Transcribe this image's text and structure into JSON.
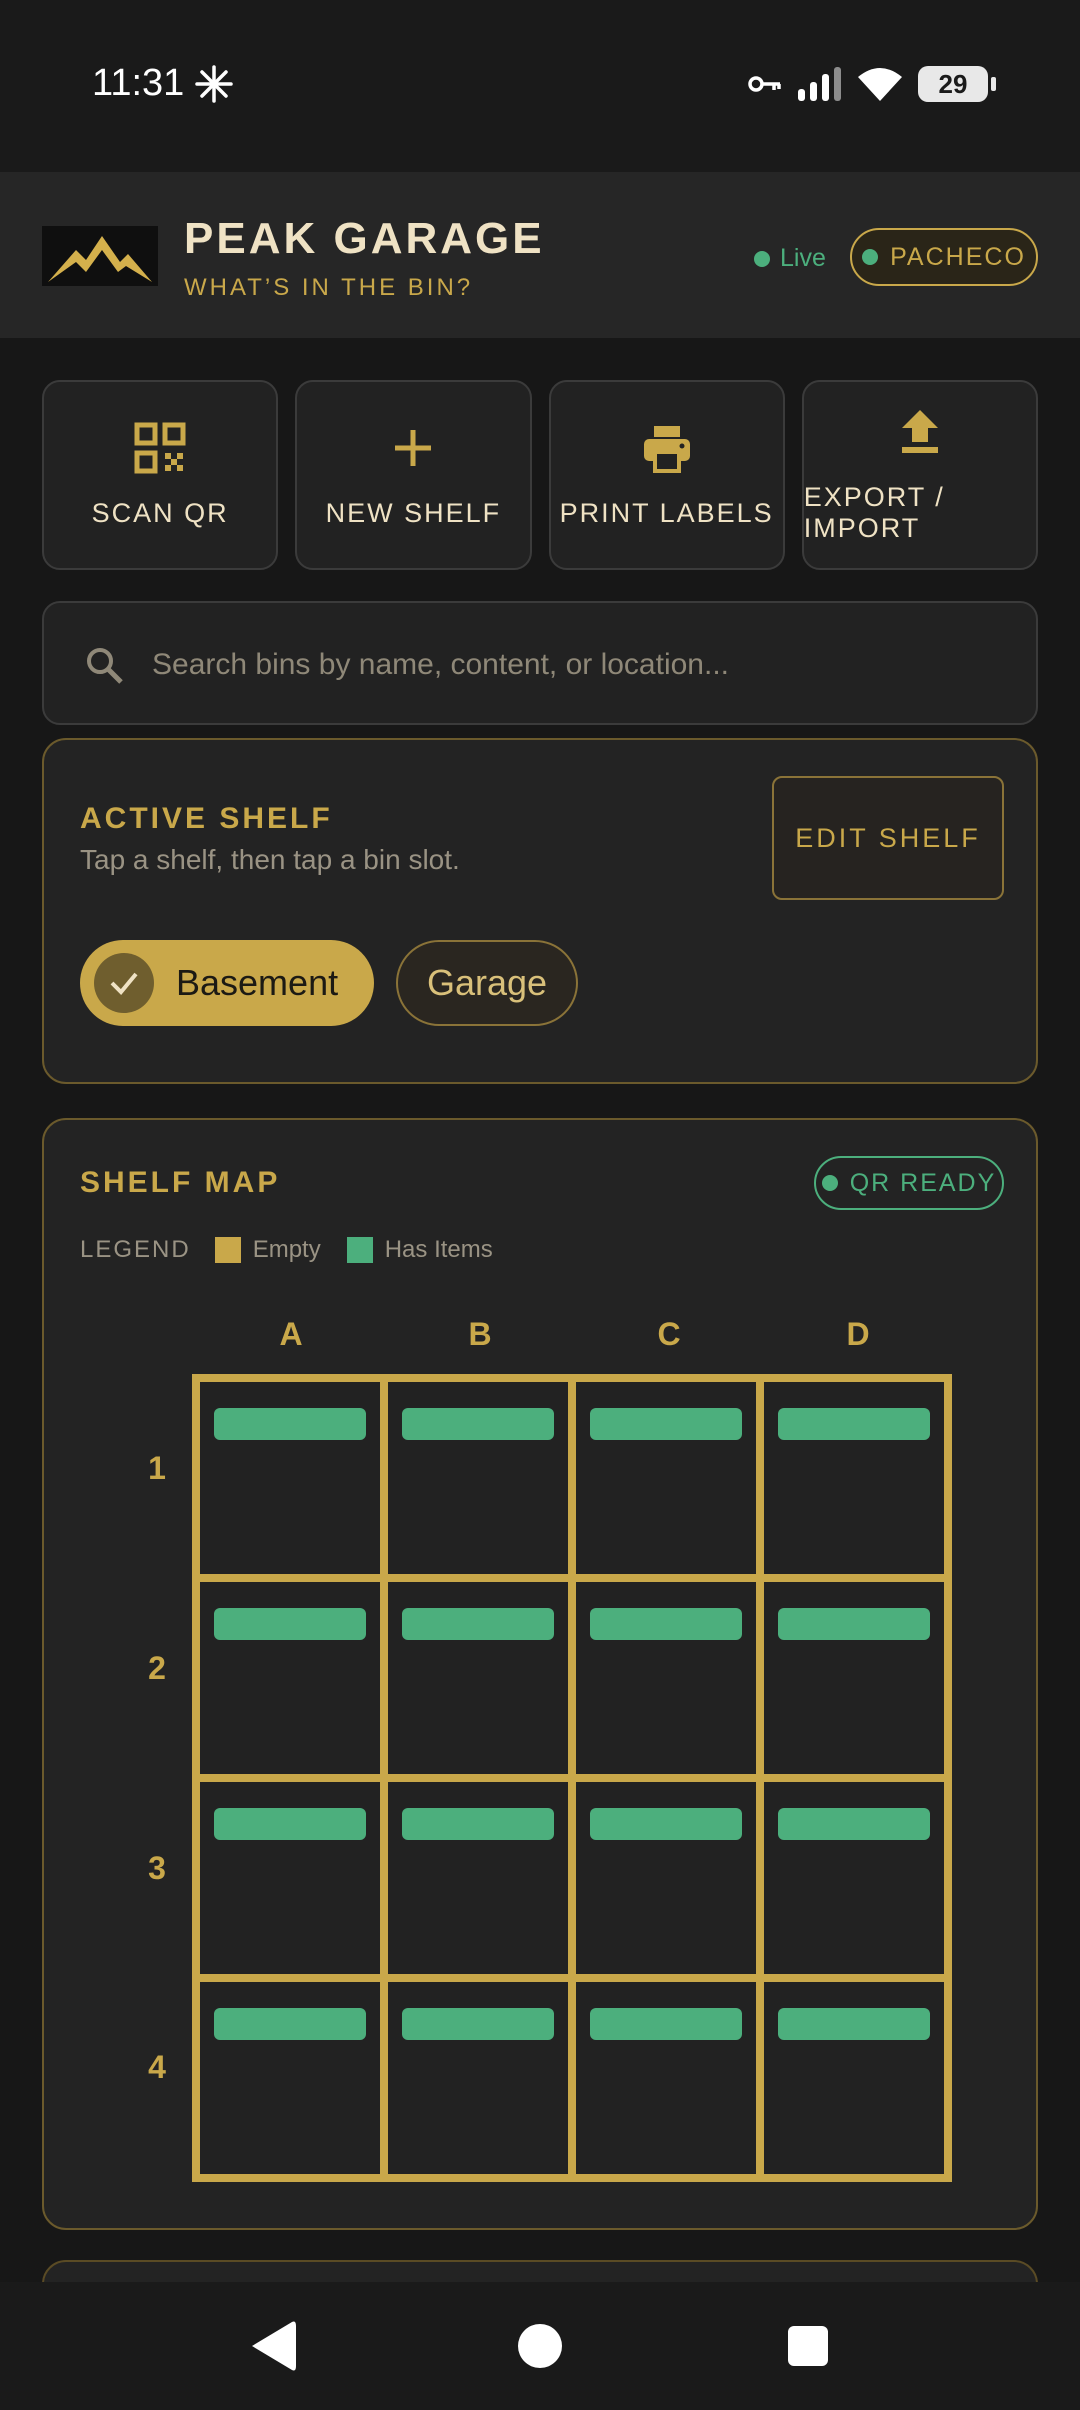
{
  "status_bar": {
    "time": "11:31",
    "battery": "29",
    "icons": [
      "spark-icon",
      "key-icon",
      "signal-icon",
      "wifi-icon",
      "battery-icon"
    ]
  },
  "header": {
    "logo": "mountain-logo",
    "title": "PEAK GARAGE",
    "subtitle": "WHAT’S IN THE BIN?",
    "live_label": "Live",
    "user_label": "PACHECO"
  },
  "actions": [
    {
      "label": "SCAN QR",
      "icon": "qr-code-icon"
    },
    {
      "label": "NEW SHELF",
      "icon": "plus-icon"
    },
    {
      "label": "PRINT LABELS",
      "icon": "printer-icon"
    },
    {
      "label": "EXPORT / IMPORT",
      "icon": "upload-icon"
    }
  ],
  "search": {
    "placeholder": "Search bins by name, content, or location...",
    "value": ""
  },
  "active_shelf": {
    "title": "ACTIVE SHELF",
    "hint": "Tap a shelf, then tap a bin slot.",
    "edit_label": "EDIT SHELF",
    "shelves": [
      {
        "label": "Basement",
        "selected": true
      },
      {
        "label": "Garage",
        "selected": false
      }
    ]
  },
  "shelf_map": {
    "title": "SHELF MAP",
    "badge": "QR READY",
    "legend_title": "LEGEND",
    "legend": [
      {
        "label": "Empty",
        "color": "#c9a84a"
      },
      {
        "label": "Has Items",
        "color": "#4caf7d"
      }
    ],
    "columns": [
      "A",
      "B",
      "C",
      "D"
    ],
    "rows": [
      "1",
      "2",
      "3",
      "4"
    ],
    "slots": [
      [
        "has-items",
        "has-items",
        "has-items",
        "has-items"
      ],
      [
        "has-items",
        "has-items",
        "has-items",
        "has-items"
      ],
      [
        "has-items",
        "has-items",
        "has-items",
        "has-items"
      ],
      [
        "has-items",
        "has-items",
        "has-items",
        "has-items"
      ]
    ]
  },
  "colors": {
    "accent": "#c9a84a",
    "success": "#4caf7d",
    "background": "#171717",
    "panel": "#232323"
  },
  "nav": {
    "icons": [
      "back-icon",
      "home-icon",
      "recents-icon"
    ]
  }
}
